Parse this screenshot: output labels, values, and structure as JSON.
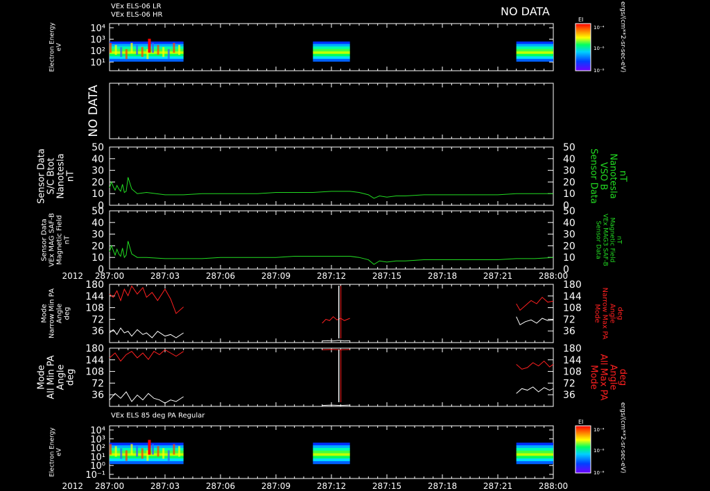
{
  "header": {
    "line1": "VEx ELS-06 LR",
    "line2": "VEx ELS-06 HR",
    "no_data": "NO DATA"
  },
  "time_axis": {
    "year": "2012",
    "ticks": [
      "287:00",
      "287:03",
      "287:06",
      "287:09",
      "287:12",
      "287:15",
      "287:18",
      "287:21",
      "288:00"
    ]
  },
  "colorbar": {
    "label": "EI",
    "unit": "ergs/(cm**2-sr-sec-eV)",
    "ticks": [
      "10⁻⁴",
      "10⁻⁶",
      "10⁻⁸"
    ]
  },
  "panel5_title": "VEx ELS 85 deg PA Regular",
  "chart_data": [
    {
      "id": "els-spectrogram",
      "type": "heatmap",
      "ylabel": [
        "Electron Energy",
        "eV"
      ],
      "yscale": "log",
      "yticks": [
        "10⁴",
        "10³",
        "10²",
        "10¹"
      ],
      "x_range": [
        "287:00",
        "288:00"
      ],
      "data_intervals": [
        [
          "287:00",
          "287:04"
        ],
        [
          "287:11",
          "287:13"
        ],
        [
          "287:22",
          "288:00"
        ]
      ]
    },
    {
      "id": "no-data-panel",
      "type": "line",
      "ylabel": [
        "NO DATA"
      ]
    },
    {
      "id": "btot",
      "type": "line",
      "ylabel": [
        "Sensor Data",
        "S/C Btot",
        "Nanotesla",
        "nT"
      ],
      "rlabel": [
        "Sensor Data",
        "VSO B",
        "Nanotesla",
        "nT"
      ],
      "ylim": [
        0,
        50
      ],
      "yticks": [
        0,
        10,
        20,
        30,
        40,
        50
      ],
      "color": "#22dd22",
      "x_hours": [
        0,
        0.1,
        0.2,
        0.3,
        0.4,
        0.5,
        0.6,
        0.7,
        0.8,
        0.9,
        1.0,
        1.2,
        1.5,
        2.0,
        3.0,
        4.0,
        5.0,
        6.0,
        7.0,
        8.0,
        9.0,
        10.0,
        11.0,
        12.0,
        12.5,
        13.0,
        13.5,
        14.0,
        14.3,
        14.6,
        15.0,
        15.5,
        16.0,
        17.0,
        18.0,
        19.0,
        20.0,
        21.0,
        22.0,
        23.0,
        24.0
      ],
      "y_nT": [
        15,
        20,
        16,
        13,
        17,
        14,
        12,
        18,
        11,
        12,
        24,
        14,
        10,
        11,
        9,
        9,
        10,
        10,
        10,
        10,
        11,
        11,
        11,
        12,
        12,
        12,
        11,
        9,
        6,
        8,
        7,
        8,
        8,
        9,
        9,
        9,
        9,
        9,
        10,
        10,
        10
      ]
    },
    {
      "id": "mag-field",
      "type": "line",
      "ylabel": [
        "Sensor Data",
        "VEx MAG SAF-B",
        "Magnetic Field",
        "nT"
      ],
      "rlabel": [
        "Sensor Data",
        "VEx MAG3 SAF-B",
        "Magnetic Field",
        "nT"
      ],
      "ylim": [
        0,
        50
      ],
      "yticks": [
        0,
        10,
        20,
        30,
        40,
        50
      ],
      "color": "#22dd22",
      "x_hours": [
        0,
        0.1,
        0.2,
        0.3,
        0.4,
        0.5,
        0.6,
        0.7,
        0.8,
        0.9,
        1.0,
        1.2,
        1.5,
        2.0,
        3.0,
        4.0,
        5.0,
        6.0,
        7.0,
        8.0,
        9.0,
        10.0,
        11.0,
        12.0,
        12.5,
        13.0,
        13.5,
        14.0,
        14.3,
        14.6,
        15.0,
        15.5,
        16.0,
        17.0,
        18.0,
        19.0,
        20.0,
        21.0,
        22.0,
        23.0,
        24.0
      ],
      "y_nT": [
        15,
        20,
        16,
        12,
        17,
        13,
        11,
        18,
        10,
        12,
        24,
        13,
        10,
        10,
        9,
        9,
        9,
        10,
        10,
        10,
        10,
        11,
        11,
        11,
        11,
        11,
        10,
        8,
        4,
        7,
        6,
        7,
        7,
        8,
        8,
        8,
        8,
        8,
        9,
        9,
        10
      ]
    },
    {
      "id": "narrow-pa",
      "type": "line",
      "ylabel": [
        "Mode",
        "Narrow Min PA",
        "Angle",
        "deg"
      ],
      "rlabel": [
        "Mode",
        "Narrow Max PA",
        "Angle",
        "deg"
      ],
      "ylim": [
        0,
        180
      ],
      "yticks": [
        36,
        72,
        108,
        144,
        180
      ],
      "max_series": {
        "color": "#ff2020",
        "segments": [
          {
            "x": [
              0,
              0.2,
              0.4,
              0.6,
              0.8,
              1.0,
              1.2,
              1.5,
              1.8,
              2.0,
              2.3,
              2.6,
              3.0,
              3.3,
              3.6,
              4.0
            ],
            "y": [
              150,
              140,
              160,
              130,
              165,
              145,
              175,
              150,
              170,
              140,
              155,
              130,
              165,
              135,
              90,
              110
            ]
          },
          {
            "x": [
              11.5,
              11.7,
              11.9,
              12.1,
              12.3,
              12.5,
              12.7,
              13.0
            ],
            "y": [
              60,
              72,
              68,
              80,
              70,
              75,
              68,
              75
            ]
          },
          {
            "x": [
              22.0,
              22.2,
              22.5,
              22.8,
              23.1,
              23.4,
              23.7,
              24.0
            ],
            "y": [
              120,
              100,
              115,
              130,
              120,
              140,
              125,
              128
            ]
          }
        ]
      },
      "min_series": {
        "color": "#ffffff",
        "segments": [
          {
            "x": [
              0,
              0.2,
              0.4,
              0.6,
              0.8,
              1.0,
              1.2,
              1.5,
              1.8,
              2.0,
              2.3,
              2.6,
              3.0,
              3.3,
              3.6,
              4.0
            ],
            "y": [
              30,
              40,
              25,
              45,
              30,
              35,
              20,
              40,
              25,
              30,
              15,
              35,
              20,
              25,
              15,
              30
            ]
          },
          {
            "x": [
              11.5,
              11.8,
              12.1,
              12.4,
              12.7,
              13.0
            ],
            "y": [
              5,
              6,
              5,
              7,
              5,
              6
            ]
          },
          {
            "x": [
              22.0,
              22.2,
              22.5,
              22.8,
              23.1,
              23.4,
              23.7,
              24.0
            ],
            "y": [
              80,
              55,
              65,
              70,
              60,
              75,
              68,
              70
            ]
          }
        ]
      }
    },
    {
      "id": "all-pa",
      "type": "line",
      "ylabel": [
        "Mode",
        "All Min PA",
        "Angle",
        "deg"
      ],
      "rlabel": [
        "Mode",
        "All Max PA",
        "Angle",
        "deg"
      ],
      "ylim": [
        0,
        180
      ],
      "yticks": [
        36,
        72,
        108,
        144,
        180
      ],
      "max_series": {
        "color": "#ff2020",
        "segments": [
          {
            "x": [
              0,
              0.3,
              0.6,
              0.9,
              1.2,
              1.5,
              1.8,
              2.1,
              2.4,
              2.7,
              3.0,
              3.3,
              3.6,
              4.0
            ],
            "y": [
              150,
              165,
              140,
              160,
              170,
              150,
              165,
              145,
              170,
              160,
              175,
              165,
              155,
              170
            ]
          },
          {
            "x": [
              11.5,
              12.0,
              12.5,
              13.0
            ],
            "y": [
              175,
              176,
              175,
              176
            ]
          },
          {
            "x": [
              22.0,
              22.3,
              22.6,
              22.9,
              23.2,
              23.5,
              23.8,
              24.0
            ],
            "y": [
              130,
              115,
              120,
              135,
              125,
              140,
              122,
              130
            ]
          }
        ]
      },
      "min_series": {
        "color": "#ffffff",
        "segments": [
          {
            "x": [
              0,
              0.3,
              0.6,
              0.9,
              1.2,
              1.5,
              1.8,
              2.1,
              2.4,
              2.7,
              3.0,
              3.3,
              3.6,
              4.0
            ],
            "y": [
              20,
              40,
              25,
              45,
              15,
              35,
              20,
              40,
              25,
              20,
              10,
              20,
              15,
              30
            ]
          },
          {
            "x": [
              11.5,
              12.0,
              12.5,
              13.0
            ],
            "y": [
              3,
              4,
              3,
              4
            ]
          },
          {
            "x": [
              22.0,
              22.3,
              22.6,
              22.9,
              23.2,
              23.5,
              23.8,
              24.0
            ],
            "y": [
              40,
              55,
              50,
              60,
              45,
              58,
              50,
              55
            ]
          }
        ]
      }
    },
    {
      "id": "els-85deg-spectrogram",
      "type": "heatmap",
      "ylabel": [
        "Electron Energy",
        "eV"
      ],
      "yscale": "log",
      "yticks": [
        "10⁴",
        "10³",
        "10²",
        "10¹",
        "10⁰",
        "10⁻¹"
      ],
      "x_range": [
        "287:00",
        "288:00"
      ],
      "data_intervals": [
        [
          "287:00",
          "287:04"
        ],
        [
          "287:11",
          "287:13"
        ],
        [
          "287:22",
          "288:00"
        ]
      ]
    }
  ]
}
